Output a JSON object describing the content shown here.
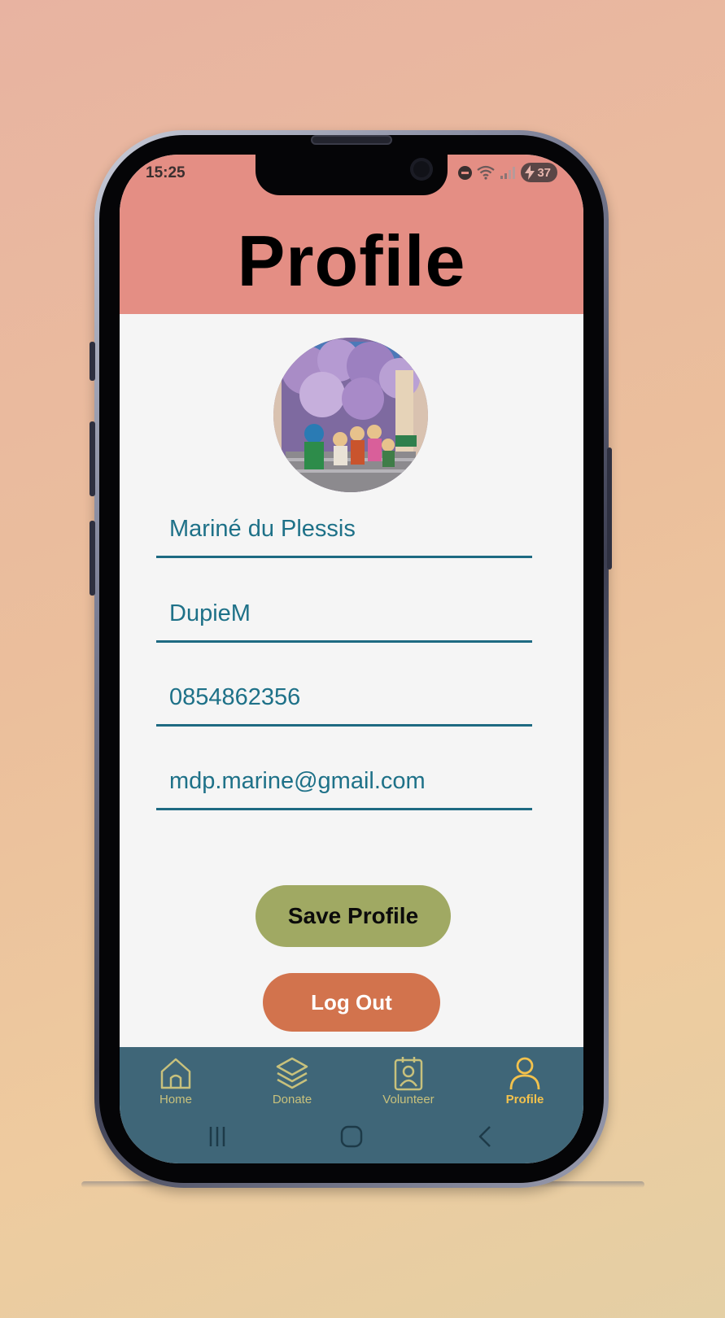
{
  "status_bar": {
    "time": "15:25",
    "battery": "37"
  },
  "header": {
    "title": "Profile"
  },
  "profile_photo": {
    "icon": "profile-photo-avatar"
  },
  "form": {
    "full_name": "Mariné du Plessis",
    "username": "DupieM",
    "phone": "0854862356",
    "email": "mdp.marine@gmail.com"
  },
  "buttons": {
    "save_label": "Save Profile",
    "logout_label": "Log Out"
  },
  "bottom_nav": {
    "items": [
      {
        "label": "Home",
        "icon": "home-icon"
      },
      {
        "label": "Donate",
        "icon": "layers-icon"
      },
      {
        "label": "Volunteer",
        "icon": "badge-icon"
      },
      {
        "label": "Profile",
        "icon": "person-icon",
        "active": true
      }
    ]
  },
  "colors": {
    "header": "#e48e84",
    "field_text": "#1e7188",
    "save_button": "#a0a963",
    "logout_button": "#d2734d",
    "nav_bar": "#3f6678",
    "nav_active": "#f3c24d"
  }
}
